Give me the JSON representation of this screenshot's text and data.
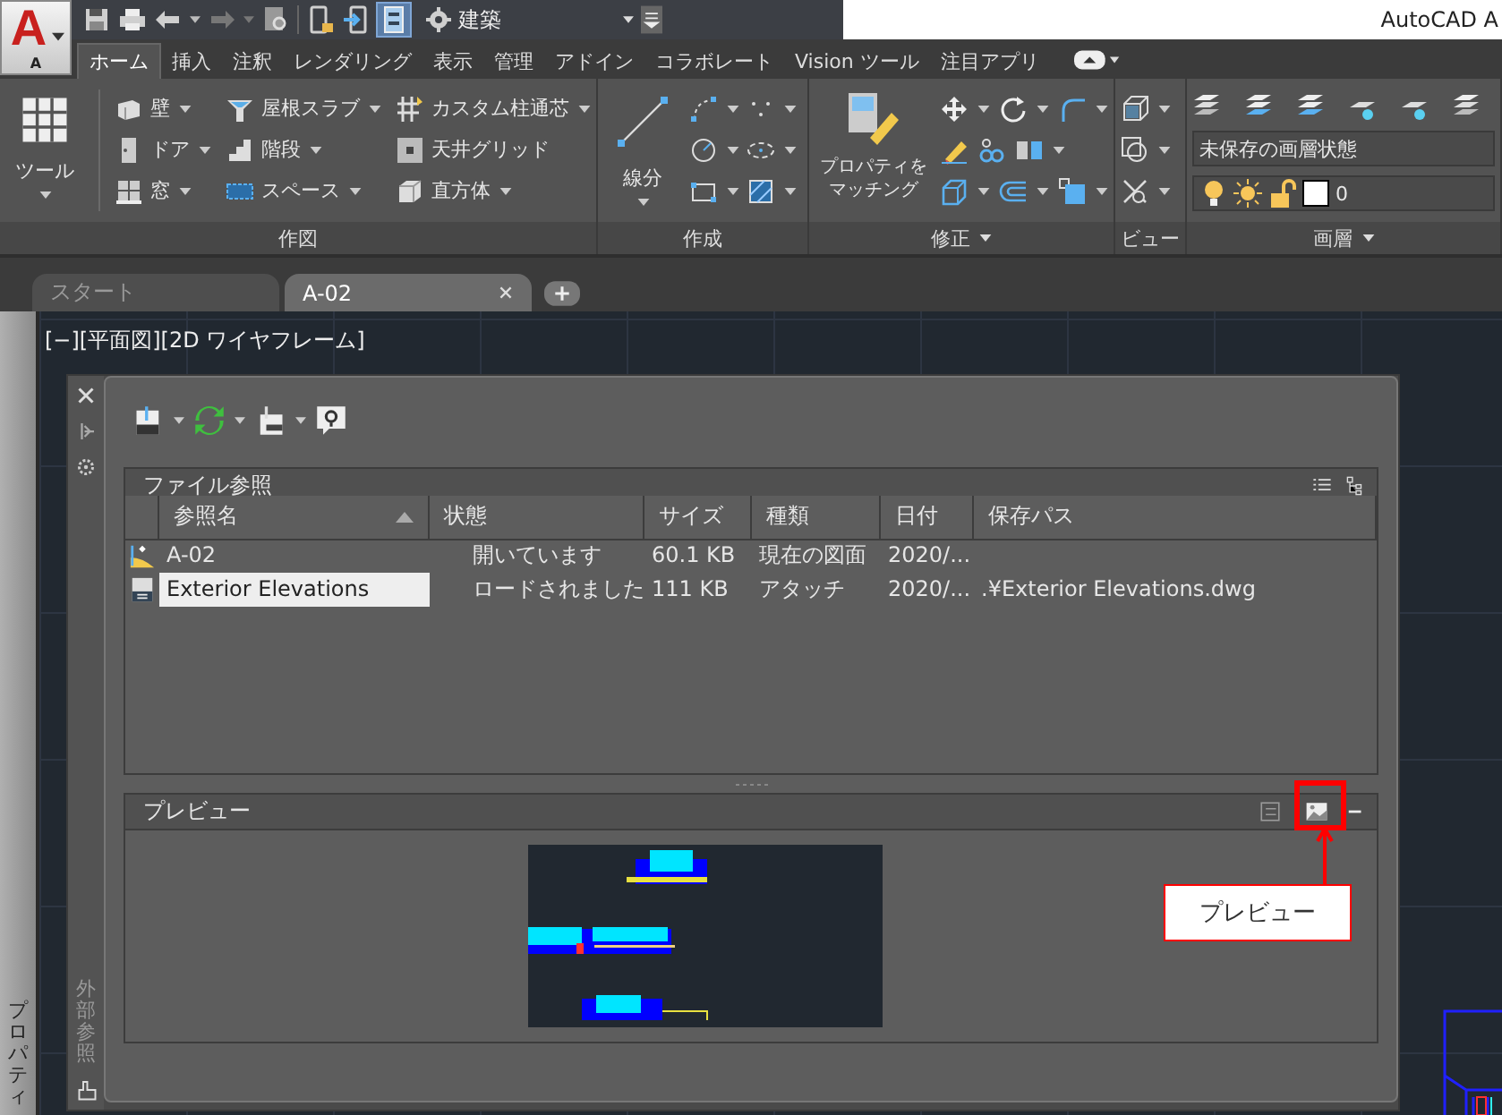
{
  "app_button": {
    "logo_letter": "A",
    "caption": "A"
  },
  "workspace": "建築",
  "window_title": "AutoCAD A",
  "ribbon": {
    "tabs": [
      {
        "label": "ホーム",
        "selected": true
      },
      {
        "label": "挿入",
        "selected": false
      },
      {
        "label": "注釈",
        "selected": false
      },
      {
        "label": "レンダリング",
        "selected": false
      },
      {
        "label": "表示",
        "selected": false
      },
      {
        "label": "管理",
        "selected": false
      },
      {
        "label": "アドイン",
        "selected": false
      },
      {
        "label": "コラボレート",
        "selected": false
      },
      {
        "label": "Vision ツール",
        "selected": false
      },
      {
        "label": "注目アプリ",
        "selected": false
      }
    ],
    "panels": [
      {
        "kind": "draw",
        "title": "作図",
        "menu": false,
        "large": {
          "label": "ツール",
          "dropdown": true
        },
        "columns": [
          [
            {
              "label": "壁",
              "dropdown": true
            },
            {
              "label": "ドア",
              "dropdown": true
            },
            {
              "label": "窓",
              "dropdown": true
            }
          ],
          [
            {
              "label": "屋根スラブ",
              "dropdown": true
            },
            {
              "label": "階段",
              "dropdown": true
            },
            {
              "label": "スペース",
              "dropdown": true
            }
          ],
          [
            {
              "label": "カスタム柱通芯",
              "dropdown": true
            },
            {
              "label": "天井グリッド",
              "dropdown": false
            },
            {
              "label": "直方体",
              "dropdown": true
            }
          ]
        ]
      },
      {
        "kind": "create",
        "title": "作成",
        "menu": false,
        "large": {
          "label": "線分",
          "dropdown": true
        }
      },
      {
        "kind": "modify",
        "title": "修正",
        "menu": true,
        "large": {
          "lines": [
            "プロパティを",
            "マッチング"
          ],
          "dropdown": false
        }
      },
      {
        "kind": "view",
        "title": "ビュー",
        "menu": false
      },
      {
        "kind": "layers",
        "title": "画層",
        "menu": true,
        "layer_state": "未保存の画層状態",
        "current_layer": "0"
      }
    ]
  },
  "file_tabs": [
    {
      "label": "スタート",
      "selected": false,
      "closable": false
    },
    {
      "label": "A-02",
      "selected": true,
      "closable": true
    }
  ],
  "viewport_label": "[−][平面図][2D ワイヤフレーム]",
  "side_palette": {
    "title": "プロパティ"
  },
  "xref_palette": {
    "title": "外部参照",
    "file_references": {
      "title": "ファイル参照",
      "columns": [
        {
          "label": "参照名",
          "sorted": true
        },
        {
          "label": "状態",
          "sorted": false
        },
        {
          "label": "サイズ",
          "sorted": false
        },
        {
          "label": "種類",
          "sorted": false
        },
        {
          "label": "日付",
          "sorted": false
        },
        {
          "label": "保存パス",
          "sorted": false
        }
      ],
      "rows": [
        {
          "kind": "current",
          "name": "A-02",
          "status": "開いています",
          "size": "60.1 KB",
          "type": "現在の図面",
          "date": "2020/...",
          "selected": false
        },
        {
          "kind": "dwg",
          "name": "Exterior Elevations",
          "status": "ロードされました",
          "size": "111 KB",
          "type": "アタッチ",
          "date": "2020/...",
          "path": ".¥Exterior Elevations.dwg",
          "selected": true
        }
      ]
    },
    "preview": {
      "title": "プレビュー",
      "mode_buttons": [
        {
          "selected": false
        },
        {
          "selected": true
        }
      ]
    },
    "callout": {
      "label": "プレビュー"
    }
  }
}
